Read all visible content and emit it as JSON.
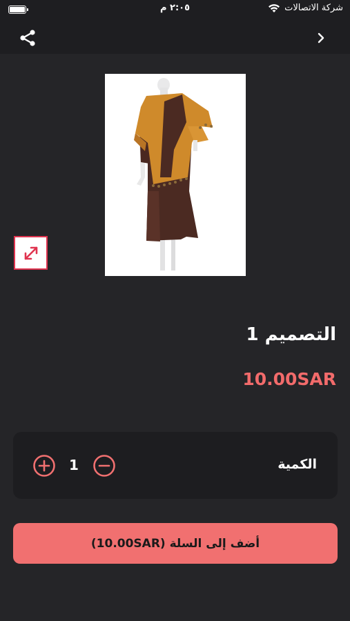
{
  "status_bar": {
    "carrier": "شركة الاتصالات",
    "time": "٢:٠٥ م",
    "battery_level": 1.0
  },
  "nav": {
    "share_icon": "share-icon",
    "back_icon": "chevron-right-icon"
  },
  "product": {
    "title": "التصميم 1",
    "price": "10.00SAR",
    "expand_icon": "expand-icon"
  },
  "quantity": {
    "label": "الكمية",
    "value": "1",
    "plus_icon": "plus-circle-icon",
    "minus_icon": "minus-circle-icon"
  },
  "cart_button": {
    "label": "أضف إلى السلة (10.00SAR)"
  },
  "colors": {
    "background": "#252528",
    "accent": "#f17070",
    "price": "#f26b6b",
    "expand_border": "#e0334f",
    "card": "#1d1d20"
  }
}
